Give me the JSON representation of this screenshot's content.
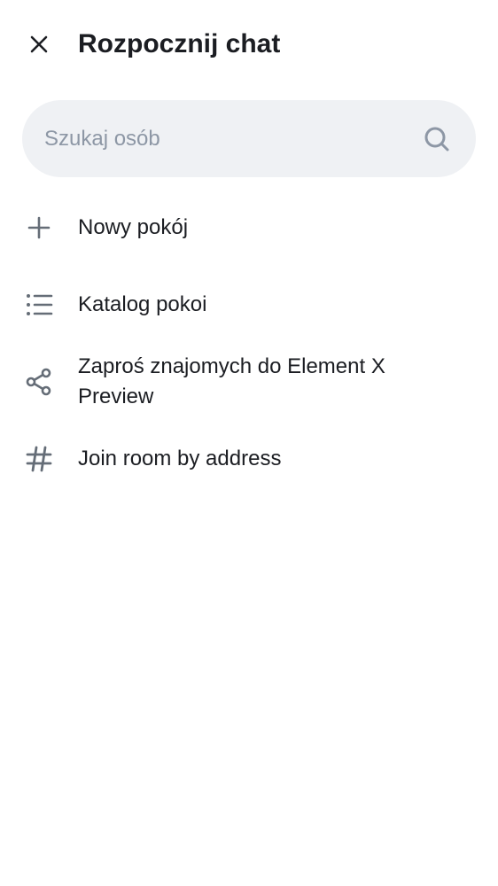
{
  "header": {
    "title": "Rozpocznij chat",
    "close_icon": "close-icon"
  },
  "search": {
    "placeholder": "Szukaj osób",
    "value": "",
    "icon": "search-icon"
  },
  "menu": {
    "items": [
      {
        "label": "Nowy pokój",
        "icon": "plus-icon"
      },
      {
        "label": "Katalog pokoi",
        "icon": "list-icon"
      },
      {
        "label": "Zaproś znajomych do Element X Preview",
        "icon": "share-icon"
      },
      {
        "label": "Join room by address",
        "icon": "hash-icon"
      }
    ]
  },
  "colors": {
    "text_primary": "#1b1d22",
    "icon": "#656d77",
    "search_bg": "#eff1f4",
    "placeholder": "#8d97a5",
    "background": "#ffffff"
  }
}
